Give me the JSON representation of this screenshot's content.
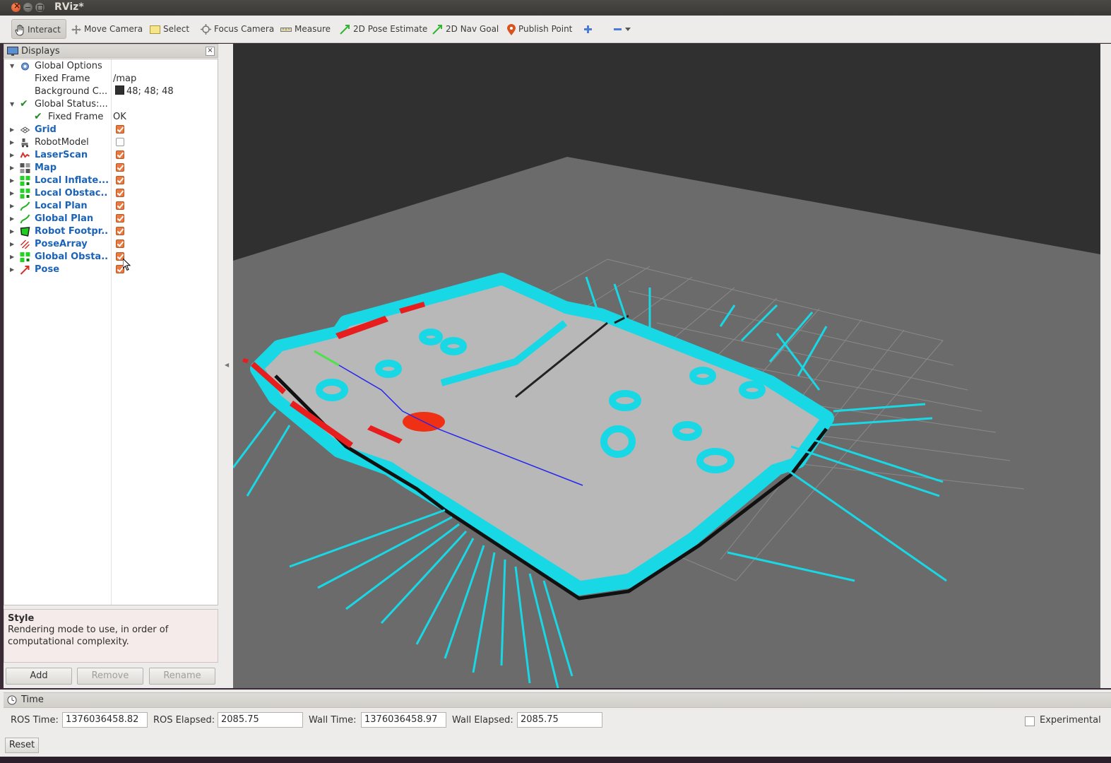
{
  "window": {
    "title": "RViz*"
  },
  "toolbar": {
    "interact": "Interact",
    "move_camera": "Move Camera",
    "select": "Select",
    "focus_camera": "Focus Camera",
    "measure": "Measure",
    "pose_estimate": "2D Pose Estimate",
    "nav_goal": "2D Nav Goal",
    "publish_point": "Publish Point"
  },
  "displays": {
    "title": "Displays",
    "global_options": "Global Options",
    "fixed_frame_label": "Fixed Frame",
    "fixed_frame_value": "/map",
    "background_label": "Background C...",
    "background_value": "48; 48; 48",
    "background_color": "#303030",
    "global_status": "Global Status:...",
    "status_fixed_frame": "Fixed Frame",
    "status_ok": "OK",
    "items": [
      {
        "label": "Grid",
        "checked": true,
        "icon": "grid-icon"
      },
      {
        "label": "RobotModel",
        "checked": false,
        "icon": "robot-model-icon"
      },
      {
        "label": "LaserScan",
        "checked": true,
        "icon": "laser-scan-icon"
      },
      {
        "label": "Map",
        "checked": true,
        "icon": "map-icon"
      },
      {
        "label": "Local Inflate...",
        "checked": true,
        "icon": "costmap-icon"
      },
      {
        "label": "Local Obstac...",
        "checked": true,
        "icon": "costmap-icon"
      },
      {
        "label": "Local Plan",
        "checked": true,
        "icon": "path-icon"
      },
      {
        "label": "Global Plan",
        "checked": true,
        "icon": "path-icon"
      },
      {
        "label": "Robot Footpr...",
        "checked": true,
        "icon": "polygon-icon"
      },
      {
        "label": "PoseArray",
        "checked": true,
        "icon": "pose-array-icon"
      },
      {
        "label": "Global Obsta...",
        "checked": true,
        "icon": "costmap-icon"
      },
      {
        "label": "Pose",
        "checked": true,
        "icon": "pose-icon"
      }
    ]
  },
  "description": {
    "title": "Style",
    "text": "Rendering mode to use, in order of computational complexity."
  },
  "buttons": {
    "add": "Add",
    "remove": "Remove",
    "rename": "Rename"
  },
  "time": {
    "title": "Time",
    "ros_time_label": "ROS Time:",
    "ros_time": "1376036458.82",
    "ros_elapsed_label": "ROS Elapsed:",
    "ros_elapsed": "2085.75",
    "wall_time_label": "Wall Time:",
    "wall_time": "1376036458.97",
    "wall_elapsed_label": "Wall Elapsed:",
    "wall_elapsed": "2085.75",
    "experimental": "Experimental",
    "reset": "Reset"
  }
}
